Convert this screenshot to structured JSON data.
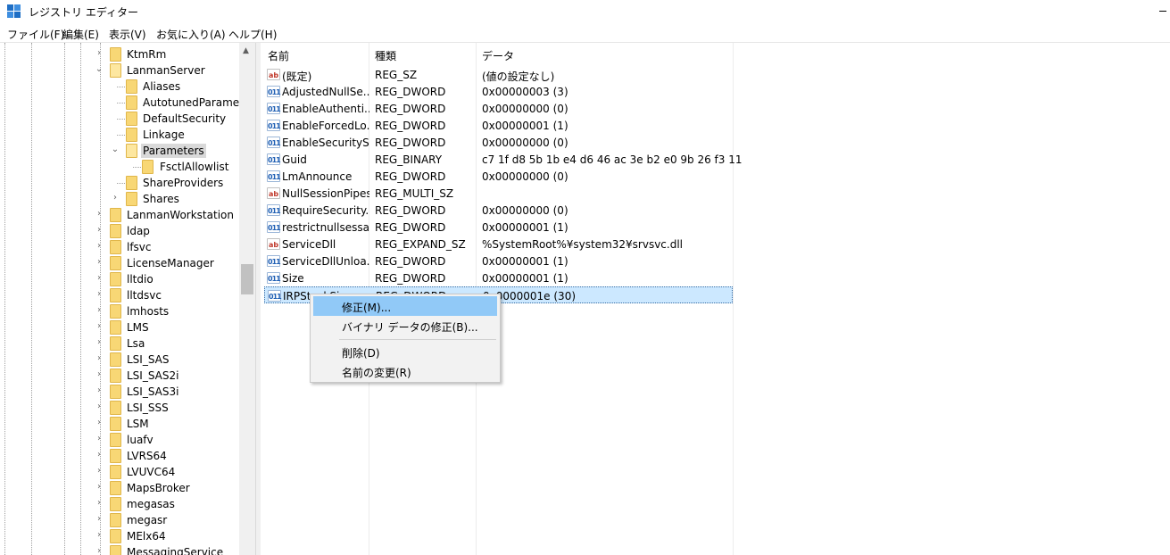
{
  "window": {
    "title": "レジストリ エディター"
  },
  "menu": [
    "ファイル(F)",
    "編集(E)",
    "表示(V)",
    "お気に入り(A)",
    "ヘルプ(H)"
  ],
  "tree": {
    "items": [
      {
        "label": "KtmRm",
        "state": "collapsed",
        "level": 0
      },
      {
        "label": "LanmanServer",
        "state": "expanded",
        "level": 0
      },
      {
        "label": "Aliases",
        "state": "leaf",
        "level": 1
      },
      {
        "label": "AutotunedParameters",
        "state": "leaf",
        "level": 1
      },
      {
        "label": "DefaultSecurity",
        "state": "leaf",
        "level": 1
      },
      {
        "label": "Linkage",
        "state": "leaf",
        "level": 1
      },
      {
        "label": "Parameters",
        "state": "expanded",
        "level": 1,
        "selected": true
      },
      {
        "label": "FsctlAllowlist",
        "state": "leaf",
        "level": 2
      },
      {
        "label": "ShareProviders",
        "state": "leaf",
        "level": 1
      },
      {
        "label": "Shares",
        "state": "collapsed",
        "level": 1
      },
      {
        "label": "LanmanWorkstation",
        "state": "collapsed",
        "level": 0
      },
      {
        "label": "ldap",
        "state": "collapsed",
        "level": 0
      },
      {
        "label": "lfsvc",
        "state": "collapsed",
        "level": 0
      },
      {
        "label": "LicenseManager",
        "state": "collapsed",
        "level": 0
      },
      {
        "label": "lltdio",
        "state": "collapsed",
        "level": 0
      },
      {
        "label": "lltdsvc",
        "state": "collapsed",
        "level": 0
      },
      {
        "label": "lmhosts",
        "state": "collapsed",
        "level": 0
      },
      {
        "label": "LMS",
        "state": "collapsed",
        "level": 0
      },
      {
        "label": "Lsa",
        "state": "collapsed",
        "level": 0
      },
      {
        "label": "LSI_SAS",
        "state": "collapsed",
        "level": 0
      },
      {
        "label": "LSI_SAS2i",
        "state": "collapsed",
        "level": 0
      },
      {
        "label": "LSI_SAS3i",
        "state": "collapsed",
        "level": 0
      },
      {
        "label": "LSI_SSS",
        "state": "collapsed",
        "level": 0
      },
      {
        "label": "LSM",
        "state": "collapsed",
        "level": 0
      },
      {
        "label": "luafv",
        "state": "collapsed",
        "level": 0
      },
      {
        "label": "LVRS64",
        "state": "collapsed",
        "level": 0
      },
      {
        "label": "LVUVC64",
        "state": "collapsed",
        "level": 0
      },
      {
        "label": "MapsBroker",
        "state": "collapsed",
        "level": 0
      },
      {
        "label": "megasas",
        "state": "collapsed",
        "level": 0
      },
      {
        "label": "megasr",
        "state": "collapsed",
        "level": 0
      },
      {
        "label": "MElx64",
        "state": "collapsed",
        "level": 0
      },
      {
        "label": "MessagingService",
        "state": "collapsed",
        "level": 0
      }
    ]
  },
  "list": {
    "columns": [
      "名前",
      "種類",
      "データ"
    ],
    "rows": [
      {
        "icon": "string-value-icon",
        "name": "(既定)",
        "type": "REG_SZ",
        "data": "(値の設定なし)"
      },
      {
        "icon": "binary-value-icon",
        "name": "AdjustedNullSe...",
        "type": "REG_DWORD",
        "data": "0x00000003 (3)"
      },
      {
        "icon": "binary-value-icon",
        "name": "EnableAuthenti...",
        "type": "REG_DWORD",
        "data": "0x00000000 (0)"
      },
      {
        "icon": "binary-value-icon",
        "name": "EnableForcedLo...",
        "type": "REG_DWORD",
        "data": "0x00000001 (1)"
      },
      {
        "icon": "binary-value-icon",
        "name": "EnableSecurityS...",
        "type": "REG_DWORD",
        "data": "0x00000000 (0)"
      },
      {
        "icon": "binary-value-icon",
        "name": "Guid",
        "type": "REG_BINARY",
        "data": "c7 1f d8 5b 1b e4 d6 46 ac 3e b2 e0 9b 26 f3 11"
      },
      {
        "icon": "binary-value-icon",
        "name": "LmAnnounce",
        "type": "REG_DWORD",
        "data": "0x00000000 (0)"
      },
      {
        "icon": "string-value-icon",
        "name": "NullSessionPipes",
        "type": "REG_MULTI_SZ",
        "data": ""
      },
      {
        "icon": "binary-value-icon",
        "name": "RequireSecurity...",
        "type": "REG_DWORD",
        "data": "0x00000000 (0)"
      },
      {
        "icon": "binary-value-icon",
        "name": "restrictnullsessa...",
        "type": "REG_DWORD",
        "data": "0x00000001 (1)"
      },
      {
        "icon": "string-value-icon",
        "name": "ServiceDll",
        "type": "REG_EXPAND_SZ",
        "data": "%SystemRoot%¥system32¥srvsvc.dll"
      },
      {
        "icon": "binary-value-icon",
        "name": "ServiceDllUnloa...",
        "type": "REG_DWORD",
        "data": "0x00000001 (1)"
      },
      {
        "icon": "binary-value-icon",
        "name": "Size",
        "type": "REG_DWORD",
        "data": "0x00000001 (1)"
      },
      {
        "icon": "binary-value-icon",
        "name": "IRPStackSize",
        "type": "REG_DWORD",
        "data": "0x0000001e (30)",
        "selected": true
      }
    ]
  },
  "context_menu": {
    "items": [
      "修正(M)...",
      "バイナリ データの修正(B)...",
      "削除(D)",
      "名前の変更(R)"
    ]
  },
  "colors": {
    "folder": "#f8d775",
    "selection": "#cce8ff",
    "menu_hover": "#91c9f7"
  }
}
